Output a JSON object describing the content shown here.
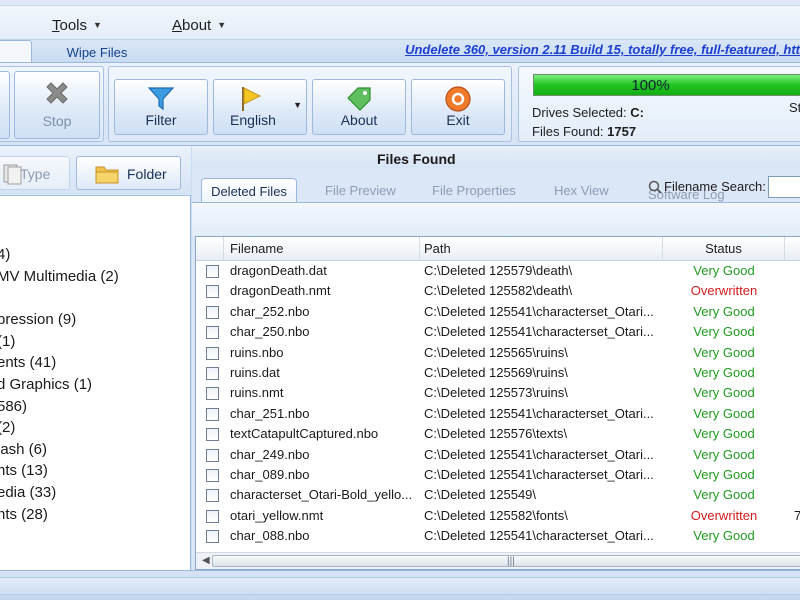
{
  "menu": {
    "items": [
      {
        "label": "Tools",
        "underline": "T",
        "rest": "ools"
      },
      {
        "label": "About",
        "underline": "A",
        "rest": "bout"
      }
    ]
  },
  "ribbon_tabs": {
    "wipe_files": "Wipe Files",
    "version_link": "Undelete 360, version 2.11 Build 15, totally free, full-featured, htt"
  },
  "toolbar": {
    "stop_label": "Stop",
    "filter_label": "Filter",
    "language_label": "English",
    "about_label": "About",
    "exit_label": "Exit"
  },
  "status": {
    "progress_percent": 100,
    "progress_text": "100%",
    "drives_label": "Drives Selected:",
    "drives_value": "C:",
    "files_label": "Files Found:",
    "files_value": "1757",
    "cut_text": "St"
  },
  "left_panel": {
    "type_button": "Type",
    "folder_button": "Folder",
    "tree": [
      "4)",
      "MV Multimedia (2)",
      "pression (9)",
      "(1)",
      "ents (41)",
      "d Graphics (1)",
      "586)",
      "(2)",
      "lash (6)",
      "nts (13)",
      "edia (33)",
      "nts (28)"
    ]
  },
  "right_panel": {
    "title": "Files Found",
    "tabs": [
      "Deleted Files",
      "File Preview",
      "File Properties",
      "Hex View",
      "Software Log"
    ],
    "search_label": "Filename Search:",
    "columns": [
      "Filename",
      "Path",
      "Status"
    ],
    "rows": [
      {
        "name": "dragonDeath.dat",
        "path": "C:\\Deleted 125579\\death\\",
        "status": "Very Good",
        "extra": ""
      },
      {
        "name": "dragonDeath.nmt",
        "path": "C:\\Deleted 125582\\death\\",
        "status": "Overwritten",
        "extra": ""
      },
      {
        "name": "char_252.nbo",
        "path": "C:\\Deleted 125541\\characterset_Otari...",
        "status": "Very Good",
        "extra": ""
      },
      {
        "name": "char_250.nbo",
        "path": "C:\\Deleted 125541\\characterset_Otari...",
        "status": "Very Good",
        "extra": ""
      },
      {
        "name": "ruins.nbo",
        "path": "C:\\Deleted 125565\\ruins\\",
        "status": "Very Good",
        "extra": ""
      },
      {
        "name": "ruins.dat",
        "path": "C:\\Deleted 125569\\ruins\\",
        "status": "Very Good",
        "extra": ""
      },
      {
        "name": "ruins.nmt",
        "path": "C:\\Deleted 125573\\ruins\\",
        "status": "Very Good",
        "extra": ""
      },
      {
        "name": "char_251.nbo",
        "path": "C:\\Deleted 125541\\characterset_Otari...",
        "status": "Very Good",
        "extra": ""
      },
      {
        "name": "textCatapultCaptured.nbo",
        "path": "C:\\Deleted 125576\\texts\\",
        "status": "Very Good",
        "extra": ""
      },
      {
        "name": "char_249.nbo",
        "path": "C:\\Deleted 125541\\characterset_Otari...",
        "status": "Very Good",
        "extra": ""
      },
      {
        "name": "char_089.nbo",
        "path": "C:\\Deleted 125541\\characterset_Otari...",
        "status": "Very Good",
        "extra": ""
      },
      {
        "name": "characterset_Otari-Bold_yello...",
        "path": "C:\\Deleted 125549\\",
        "status": "Very Good",
        "extra": ""
      },
      {
        "name": "otari_yellow.nmt",
        "path": "C:\\Deleted 125582\\fonts\\",
        "status": "Overwritten",
        "extra": "7"
      },
      {
        "name": "char_088.nbo",
        "path": "C:\\Deleted 125541\\characterset_Otari...",
        "status": "Very Good",
        "extra": ""
      }
    ]
  },
  "colors": {
    "status_good": "#1f9a1f",
    "status_overwritten": "#d01c1c",
    "link": "#1d3fd0",
    "progress_fill": "#22c322"
  }
}
